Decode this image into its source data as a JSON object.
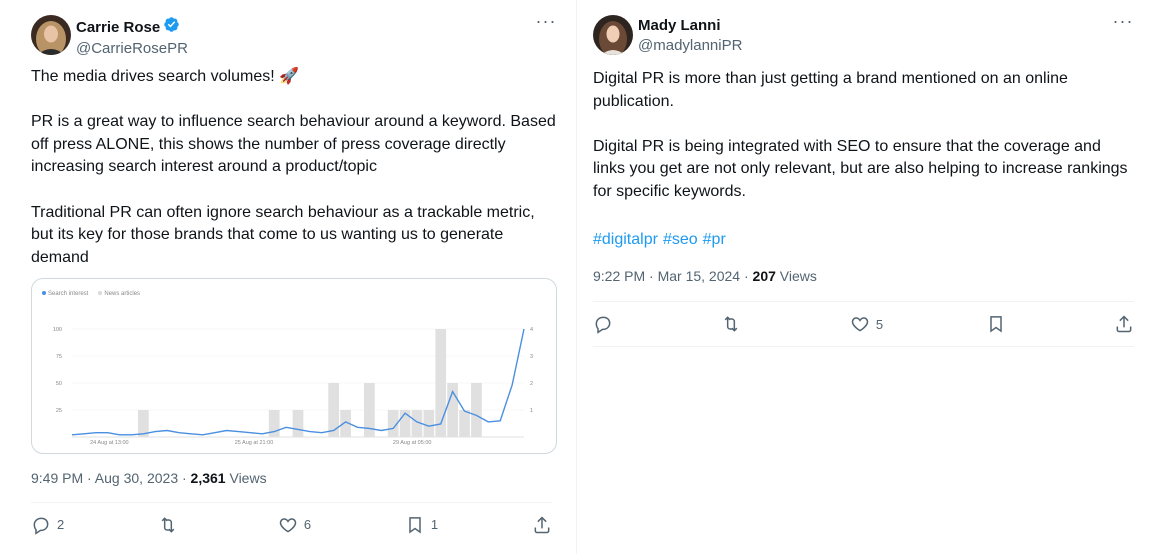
{
  "left_tweet": {
    "display_name": "Carrie Rose",
    "handle": "@CarrieRosePR",
    "text": "The media drives search volumes! 🚀\n\nPR is a great way to influence search behaviour around a keyword. Based off press ALONE, this shows the number of press coverage directly increasing search interest around a product/topic\n\nTraditional PR can often ignore search behaviour as a trackable metric, but its key for those brands that come to us wanting us to generate demand",
    "time": "9:49 PM · Aug 30, 2023 · ",
    "views_count": "2,361",
    "views_label": " Views",
    "replies": "2",
    "reposts": "",
    "likes": "6",
    "bookmarks": "1"
  },
  "right_tweet": {
    "display_name": "Mady Lanni",
    "handle": "@madylanniPR",
    "text": "Digital PR is more than just getting a brand mentioned on an online publication.\n\nDigital PR is being integrated with SEO to ensure that the coverage and links you get are not only relevant, but are also helping to increase rankings for specific keywords.",
    "hashtags": [
      "#digitalpr",
      "#seo",
      "#pr"
    ],
    "time": "9:22 PM · Mar 15, 2024 · ",
    "views_count": "207",
    "views_label": " Views",
    "replies": "",
    "reposts": "",
    "likes": "5",
    "bookmarks": ""
  },
  "icons": {
    "more": "more-horizontal-icon",
    "verified": "verified-badge-icon",
    "reply": "reply-icon",
    "repost": "repost-icon",
    "like": "heart-icon",
    "bookmark": "bookmark-icon",
    "share": "share-icon"
  },
  "colors": {
    "accent": "#1d9bf0",
    "text": "#0f1419",
    "muted": "#536471",
    "chart_line": "#4a8fe0",
    "chart_bar": "#e0e0e0"
  },
  "chart_data": {
    "type": "line",
    "legend": [
      "Search interest",
      "News articles"
    ],
    "x_tick_labels": [
      "24 Aug at 13:00",
      "25 Aug at 21:00",
      "29 Aug at 05:00"
    ],
    "y_left_ticks": [
      "100",
      "75",
      "50",
      "25"
    ],
    "y_right_ticks": [
      "4",
      "3",
      "2",
      "1"
    ],
    "ylim_left": [
      0,
      100
    ],
    "ylim_right": [
      0,
      4
    ],
    "series": [
      {
        "name": "Search interest",
        "axis": "left",
        "values": [
          2,
          3,
          4,
          4,
          2,
          2,
          3,
          5,
          6,
          4,
          3,
          2,
          4,
          6,
          5,
          4,
          3,
          5,
          9,
          7,
          5,
          4,
          6,
          14,
          9,
          8,
          6,
          8,
          22,
          14,
          10,
          12,
          42,
          24,
          20,
          14,
          15,
          48,
          100
        ]
      },
      {
        "name": "News articles",
        "axis": "right",
        "values": [
          0,
          0,
          0,
          0,
          0,
          0,
          1,
          0,
          0,
          0,
          0,
          0,
          0,
          0,
          0,
          0,
          0,
          1,
          0,
          1,
          0,
          0,
          2,
          1,
          0,
          2,
          0,
          1,
          1,
          1,
          1,
          4,
          2,
          1,
          2,
          0,
          0,
          0,
          0
        ]
      }
    ],
    "grid": true
  }
}
